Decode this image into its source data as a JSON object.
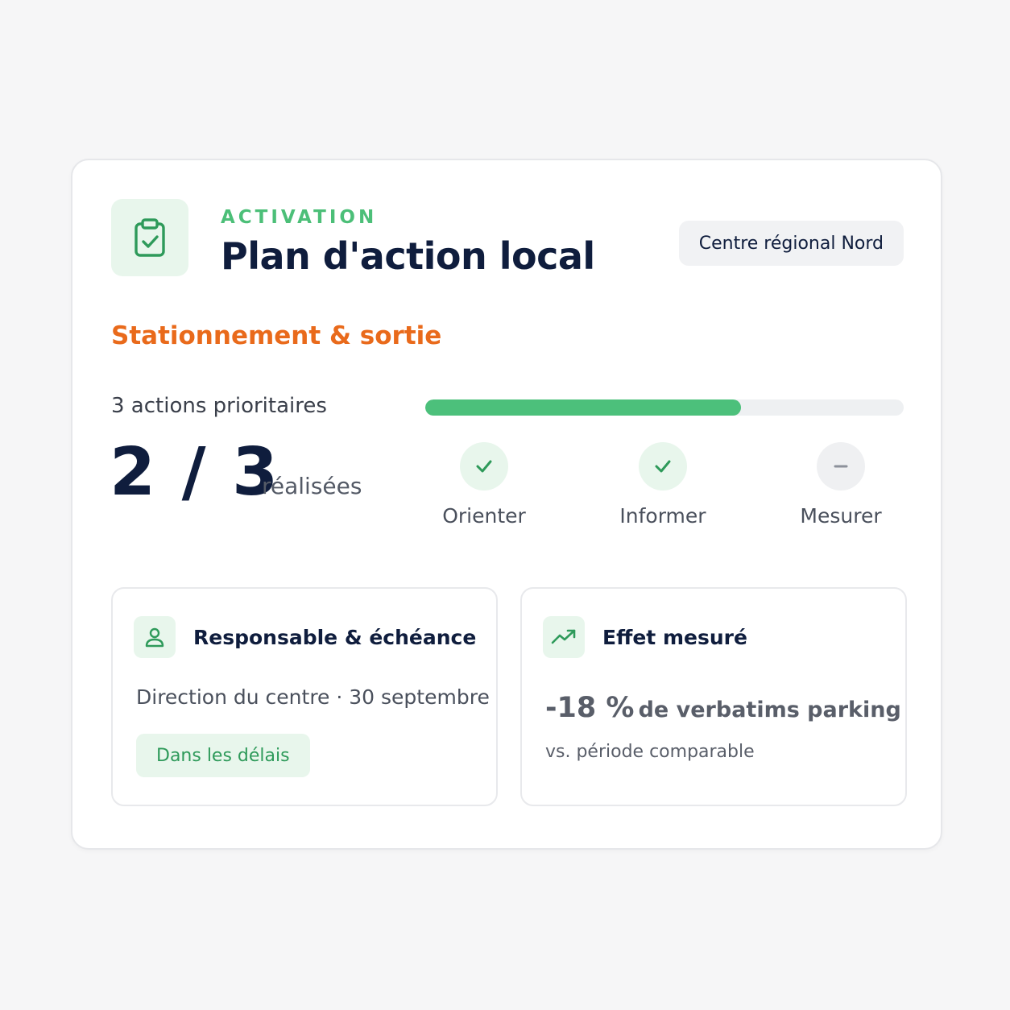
{
  "header": {
    "eyebrow": "ACTIVATION",
    "title": "Plan d'action local",
    "region": "Centre régional Nord",
    "icon": "clipboard-check-icon"
  },
  "topic": "Stationnement & sortie",
  "summary": {
    "label": "3 actions prioritaires",
    "count": "2 / 3",
    "suffix": "réalisées",
    "progress": 0.66
  },
  "steps": [
    {
      "label": "Orienter",
      "status": "done",
      "icon": "check-icon"
    },
    {
      "label": "Informer",
      "status": "done",
      "icon": "check-icon"
    },
    {
      "label": "Mesurer",
      "status": "pending",
      "icon": "minus-icon"
    }
  ],
  "owner_card": {
    "title": "Responsable & échéance",
    "icon": "user-icon",
    "owner": "Direction du centre · 30 septembre",
    "status": "Dans les délais"
  },
  "effect_card": {
    "title": "Effet mesuré",
    "icon": "trend-up-icon",
    "value": "-18 %",
    "value_text": "de verbatims parking",
    "note": "vs. période comparable"
  },
  "colors": {
    "accent_green": "#4cc07b",
    "accent_orange": "#e96a1b",
    "navy": "#0f1d3d"
  }
}
